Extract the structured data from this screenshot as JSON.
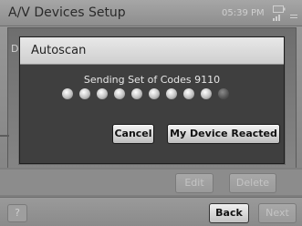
{
  "window": {
    "title": "A/V Devices Setup",
    "clock": "05:39 PM",
    "status_icons": [
      "battery-icon",
      "signal-icon"
    ]
  },
  "background": {
    "letter": "D"
  },
  "dialog": {
    "title": "Autoscan",
    "message": "Sending Set of Codes 9110",
    "progress_dots_total": 10,
    "progress_dots_active": 9,
    "buttons": {
      "cancel": "Cancel",
      "reacted": "My Device Reacted"
    }
  },
  "toolbar": {
    "edit": "Edit",
    "delete": "Delete"
  },
  "footer": {
    "help": "?",
    "back": "Back",
    "next": "Next"
  }
}
